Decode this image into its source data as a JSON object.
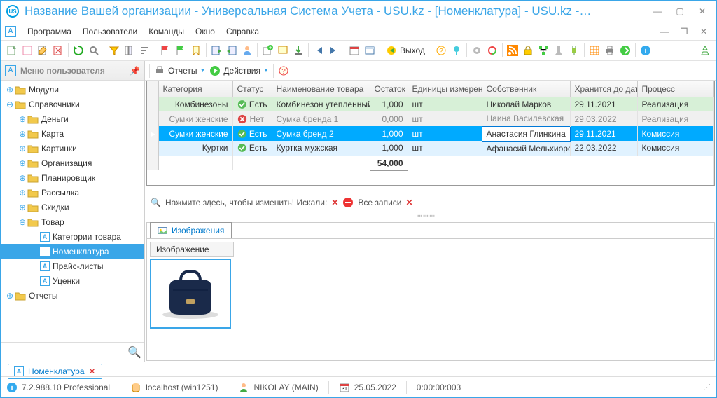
{
  "window": {
    "title": "Название Вашей организации - Универсальная Система Учета - USU.kz - [Номенклатура] - USU.kz -…"
  },
  "menu": {
    "program": "Программа",
    "users": "Пользователи",
    "commands": "Команды",
    "window": "Окно",
    "help": "Справка"
  },
  "toolbar_exit": "Выход",
  "sidebar": {
    "title": "Меню пользователя",
    "items": [
      {
        "label": "Модули",
        "level": 0,
        "folder": true,
        "toggle": "+"
      },
      {
        "label": "Справочники",
        "level": 0,
        "folder": true,
        "toggle": "-"
      },
      {
        "label": "Деньги",
        "level": 1,
        "folder": true,
        "toggle": "+"
      },
      {
        "label": "Карта",
        "level": 1,
        "folder": true,
        "toggle": "+"
      },
      {
        "label": "Картинки",
        "level": 1,
        "folder": true,
        "toggle": "+"
      },
      {
        "label": "Организация",
        "level": 1,
        "folder": true,
        "toggle": "+"
      },
      {
        "label": "Планировщик",
        "level": 1,
        "folder": true,
        "toggle": "+"
      },
      {
        "label": "Рассылка",
        "level": 1,
        "folder": true,
        "toggle": "+"
      },
      {
        "label": "Скидки",
        "level": 1,
        "folder": true,
        "toggle": "+"
      },
      {
        "label": "Товар",
        "level": 1,
        "folder": true,
        "toggle": "-"
      },
      {
        "label": "Категории товара",
        "level": 2,
        "a": true
      },
      {
        "label": "Номенклатура",
        "level": 2,
        "a": true,
        "selected": true
      },
      {
        "label": "Прайс-листы",
        "level": 2,
        "a": true
      },
      {
        "label": "Уценки",
        "level": 2,
        "a": true
      },
      {
        "label": "Отчеты",
        "level": 0,
        "folder": true,
        "toggle": "+"
      }
    ]
  },
  "content_toolbar": {
    "reports": "Отчеты",
    "actions": "Действия"
  },
  "grid": {
    "columns": [
      "Категория",
      "Статус",
      "Наименование товара",
      "Остаток",
      "Единицы измерения",
      "Собственник",
      "Хранится до даты",
      "Процесс"
    ],
    "rows": [
      {
        "cat": "Комбинезоны",
        "status_ok": true,
        "status": "Есть",
        "name": "Комбинезон утепленный",
        "qty": "1,000",
        "unit": "шт",
        "owner": "Николай Марков",
        "date": "29.11.2021",
        "proc": "Реализация",
        "cls": "r-green"
      },
      {
        "cat": "Сумки женские",
        "status_ok": false,
        "status": "Нет",
        "name": "Сумка бренда 1",
        "qty": "0,000",
        "unit": "шт",
        "owner": "Наина Василевская",
        "date": "29.03.2022",
        "proc": "Реализация",
        "cls": "r-gray"
      },
      {
        "cat": "Сумки женские",
        "status_ok": true,
        "status": "Есть",
        "name": "Сумка бренд 2",
        "qty": "1,000",
        "unit": "шт",
        "owner": "Анастасия Глинкина",
        "date": "29.11.2021",
        "proc": "Комиссия",
        "cls": "r-sel"
      },
      {
        "cat": "Куртки",
        "status_ok": true,
        "status": "Есть",
        "name": "Куртка мужская",
        "qty": "1,000",
        "unit": "шт",
        "owner": "Афанасий Мельхиоров",
        "date": "22.03.2022",
        "proc": "Комиссия",
        "cls": "r-blue"
      }
    ],
    "sum": "54,000"
  },
  "filter": {
    "hint": "Нажмите здесь, чтобы изменить! Искали:",
    "all": "Все записи"
  },
  "images": {
    "tab": "Изображения",
    "label": "Изображение"
  },
  "bottom_tab": "Номенклатура",
  "status": {
    "version": "7.2.988.10 Professional",
    "db": "localhost (win1251)",
    "user": "NIKOLAY (MAIN)",
    "date": "25.05.2022",
    "time": "0:00:00:003"
  }
}
